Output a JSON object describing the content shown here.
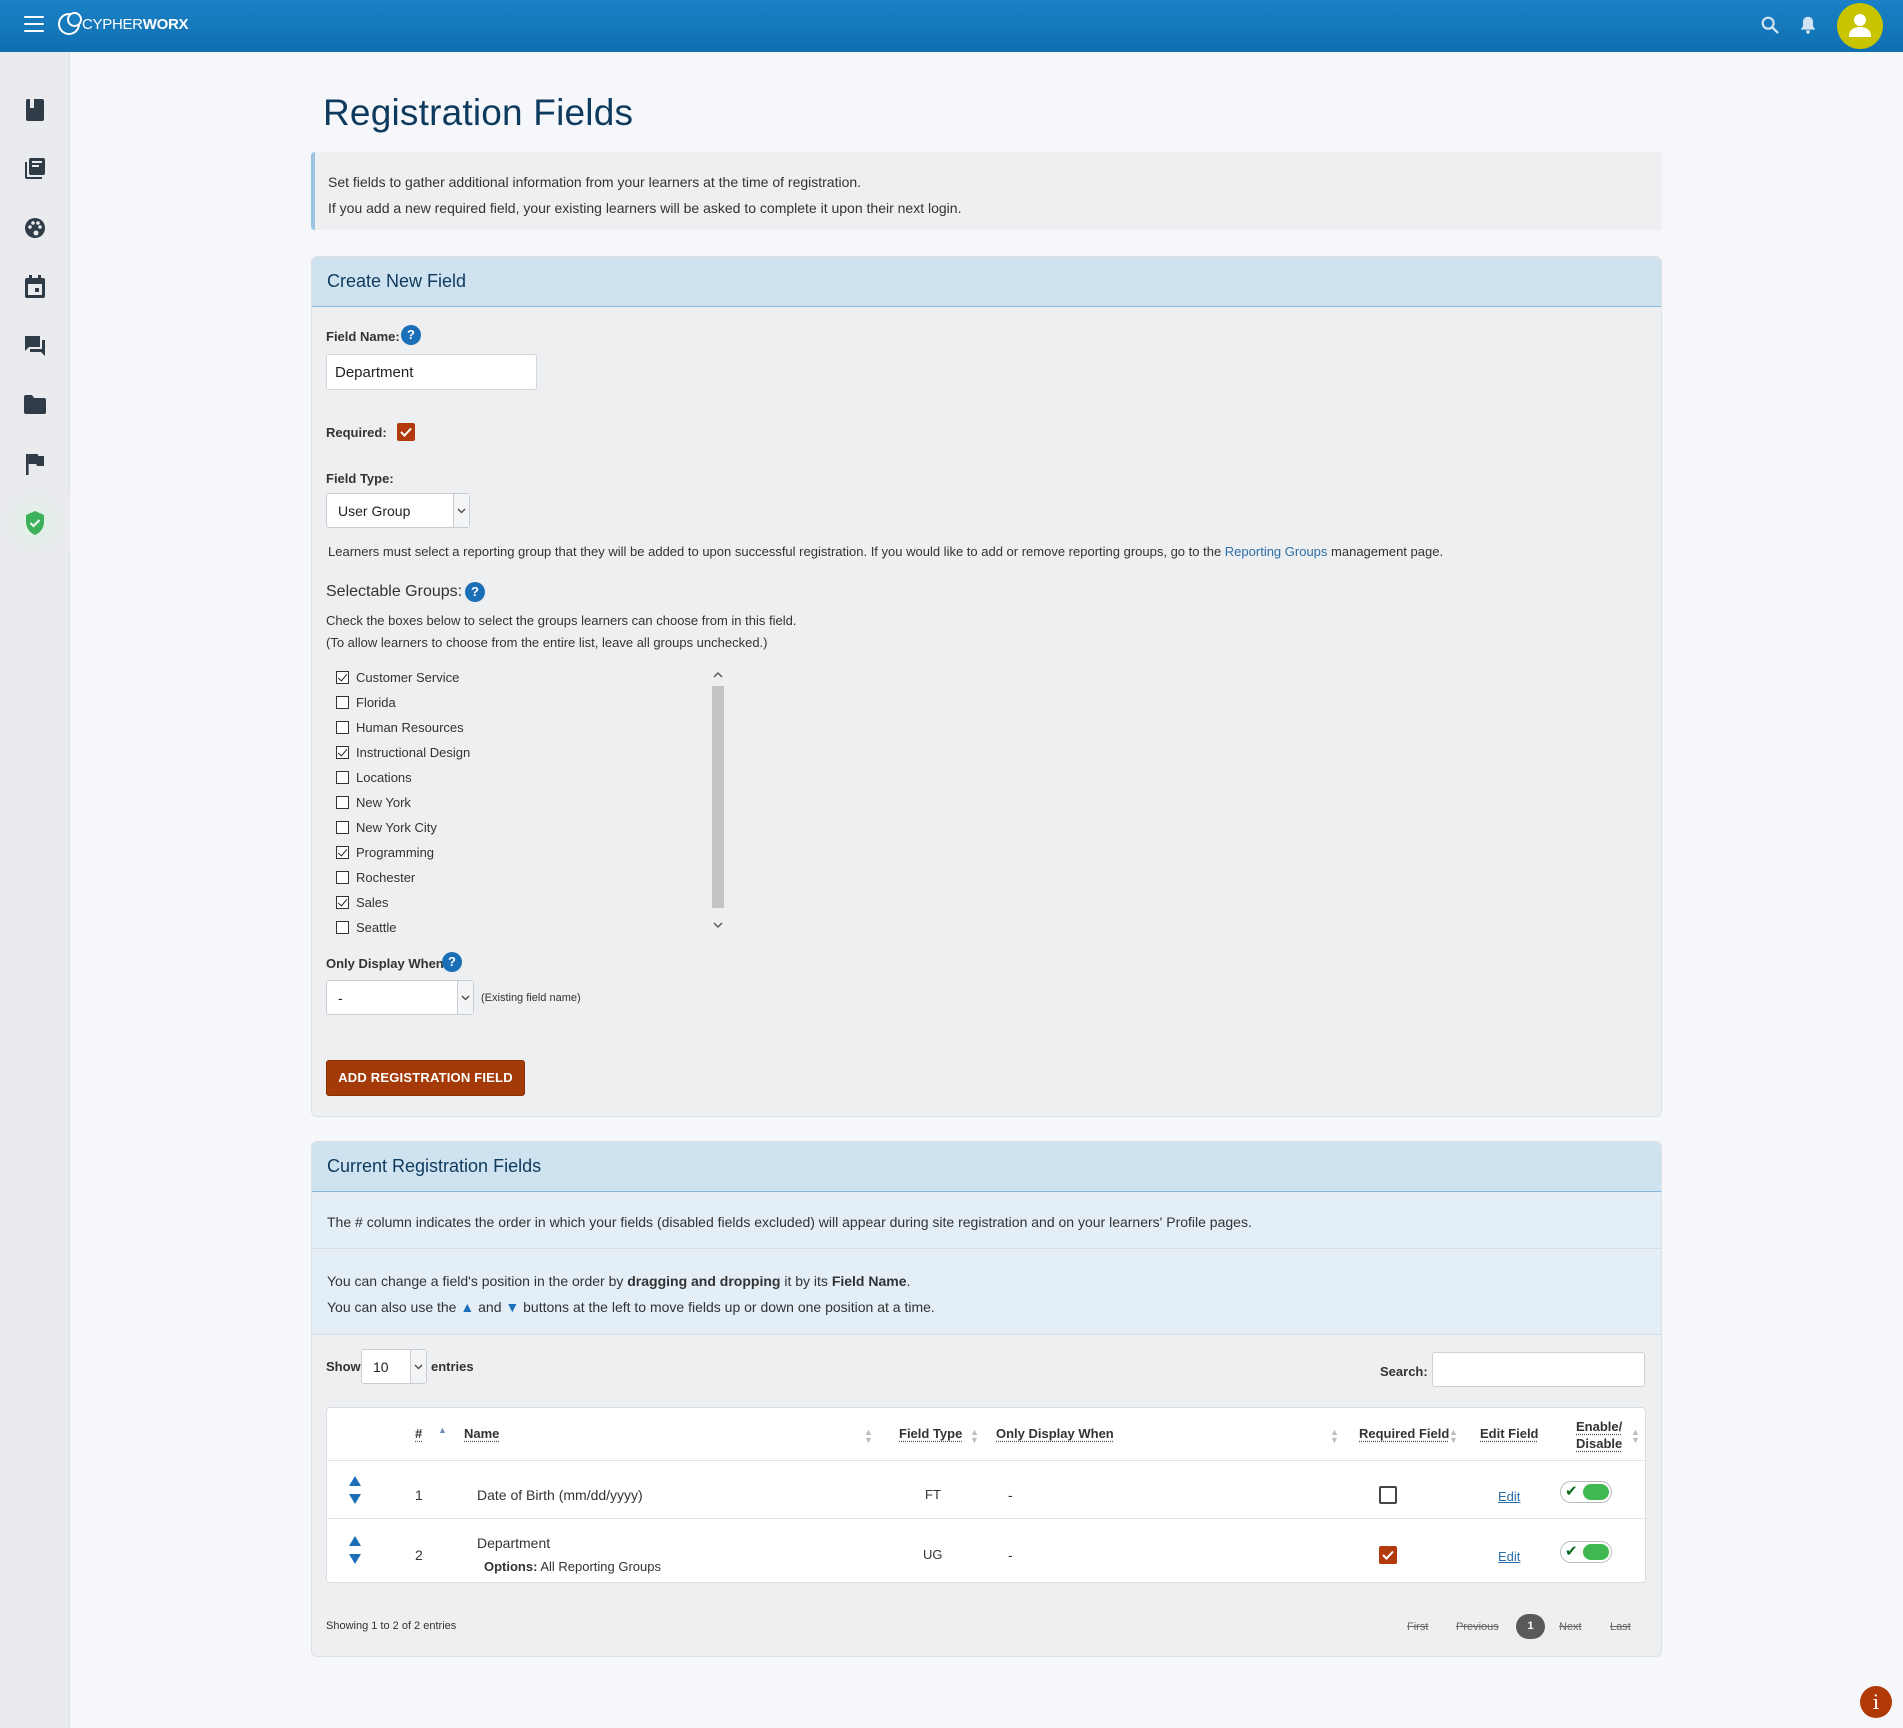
{
  "app": {
    "brand_part1": "CYPHER",
    "brand_part2": "WORX",
    "colors": {
      "topbar": "#1a7fc1",
      "accent": "#a33a07",
      "heading": "#0e3a5e",
      "link": "#2c6ea7",
      "toggle_on": "#3fb94f"
    }
  },
  "sidebar": {
    "items": [
      {
        "icon": "book-icon"
      },
      {
        "icon": "library-icon"
      },
      {
        "icon": "palette-icon"
      },
      {
        "icon": "calendar-icon"
      },
      {
        "icon": "forum-icon"
      },
      {
        "icon": "folder-icon"
      },
      {
        "icon": "flag-icon"
      },
      {
        "icon": "shield-check-icon",
        "active": true
      }
    ]
  },
  "page": {
    "title": "Registration Fields",
    "intro_line1": "Set fields to gather additional information from your learners at the time of registration.",
    "intro_line2": "If you add a new required field, your existing learners will be asked to complete it upon their next login."
  },
  "create": {
    "header": "Create New Field",
    "field_name_label": "Field Name:",
    "field_name_value": "Department",
    "required_label": "Required:",
    "required_checked": true,
    "field_type_label": "Field Type:",
    "field_type_value": "User Group",
    "note_pre": "Learners must select a reporting group that they will be added to upon successful registration. If you would like to add or remove reporting groups, go to the ",
    "note_link": "Reporting Groups",
    "note_post": " management page.",
    "selectable_label": "Selectable Groups:",
    "selectable_hint1": "Check the boxes below to select the groups learners can choose from in this field.",
    "selectable_hint2": "(To allow learners to choose from the entire list, leave all groups unchecked.)",
    "groups": [
      {
        "name": "Customer Service",
        "checked": true
      },
      {
        "name": "Florida",
        "checked": false
      },
      {
        "name": "Human Resources",
        "checked": false
      },
      {
        "name": "Instructional Design",
        "checked": true
      },
      {
        "name": "Locations",
        "checked": false
      },
      {
        "name": "New York",
        "checked": false
      },
      {
        "name": "New York City",
        "checked": false
      },
      {
        "name": "Programming",
        "checked": true
      },
      {
        "name": "Rochester",
        "checked": false
      },
      {
        "name": "Sales",
        "checked": true
      },
      {
        "name": "Seattle",
        "checked": false
      }
    ],
    "only_display_label": "Only Display When:",
    "only_display_value": "-",
    "only_display_hint": "(Existing field name)",
    "add_button": "ADD REGISTRATION FIELD"
  },
  "current": {
    "header": "Current Registration Fields",
    "order_note": "The # column indicates the order in which your fields (disabled fields excluded) will appear during site registration and on your learners' Profile pages.",
    "drag_pre": "You can change a field's position in the order by ",
    "drag_bold": "dragging and dropping",
    "drag_mid": " it by its ",
    "drag_bold2": "Field Name",
    "drag_post": ".",
    "arrows_pre": "You can also use the ",
    "arrows_and": " and ",
    "arrows_post": " buttons at the left to move fields up or down one position at a time.",
    "show_label": "Show",
    "show_value": "10",
    "entries_label": "entries",
    "search_label": "Search:",
    "search_value": "",
    "columns": {
      "num": "#",
      "name": "Name",
      "field_type": "Field Type",
      "only_display": "Only Display When",
      "required": "Required Field",
      "edit": "Edit Field",
      "enable_line1": "Enable/",
      "enable_line2": "Disable"
    },
    "rows": [
      {
        "num": "1",
        "name": "Date of Birth (mm/dd/yyyy)",
        "options_label": "",
        "options_value": "",
        "type": "FT",
        "only_display": "-",
        "required": false,
        "edit": "Edit",
        "enabled": true
      },
      {
        "num": "2",
        "name": "Department",
        "options_label": "Options:",
        "options_value": " All Reporting Groups",
        "type": "UG",
        "only_display": "-",
        "required": true,
        "edit": "Edit",
        "enabled": true
      }
    ],
    "showing": "Showing 1 to 2 of 2 entries",
    "pager": {
      "first": "First",
      "previous": "Previous",
      "current": "1",
      "next": "Next",
      "last": "Last"
    }
  },
  "fab": {
    "label": "i"
  }
}
